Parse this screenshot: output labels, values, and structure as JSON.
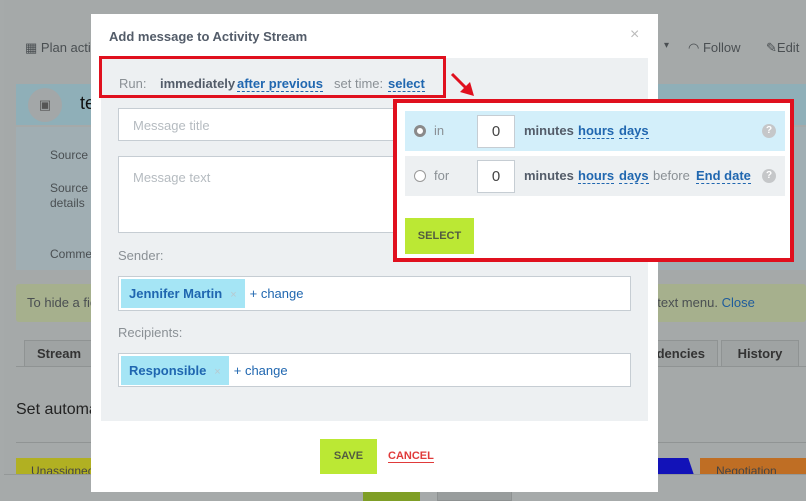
{
  "background": {
    "toolbar": {
      "plan": "Plan acti",
      "follow": "Follow",
      "edit": "Edit"
    },
    "entity_title": "te",
    "fields": [
      "Source",
      "Source details",
      "Comme"
    ],
    "notice": {
      "left": "To hide a fie",
      "right": "ntext menu.",
      "close": "Close"
    },
    "tabs": [
      "Stream",
      "ndencies",
      "History"
    ],
    "automation": "Set automa",
    "stages": [
      "Unassigned",
      "Negotiation"
    ]
  },
  "dialog": {
    "title": "Add message to Activity Stream",
    "close": "×",
    "run": {
      "label": "Run:",
      "immediately": "immediately",
      "after_previous": "after previous",
      "set_time_label": "set time:",
      "select": "select"
    },
    "title_placeholder": "Message title",
    "text_placeholder": "Message text",
    "sender_label": "Sender:",
    "sender": "Jennifer Martin",
    "recipients_label": "Recipients:",
    "recipient": "Responsible",
    "change": "+ change",
    "remove": "×",
    "save": "SAVE",
    "cancel": "CANCEL"
  },
  "popup": {
    "rows": [
      {
        "prefix": "in",
        "value": "0",
        "minutes": "minutes",
        "hours": "hours",
        "days": "days",
        "selected": true
      },
      {
        "prefix": "for",
        "value": "0",
        "minutes": "minutes",
        "hours": "hours",
        "days": "days",
        "before": "before",
        "end": "End date",
        "selected": false
      }
    ],
    "help": "?",
    "select": "SELECT"
  },
  "colors": {
    "accent_green": "#bbe834",
    "link": "#2067b0",
    "highlight": "#e0101e",
    "cancel": "#e03a3a"
  }
}
